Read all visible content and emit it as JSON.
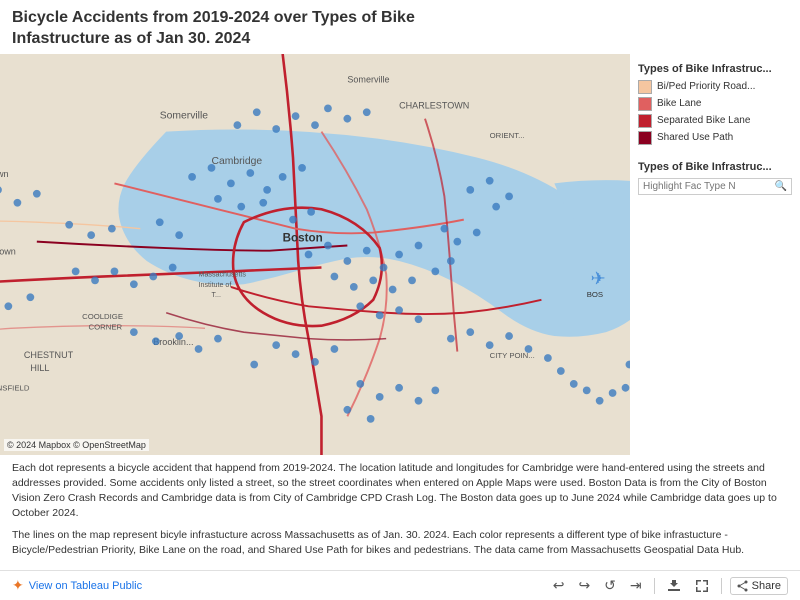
{
  "title": {
    "line1": "Bicycle Accidents from 2019-2024 over Types of Bike",
    "line2": "Infastructure as of Jan 30. 2024"
  },
  "legend": {
    "title": "Types of Bike Infrastruc...",
    "items": [
      {
        "label": "Bi/Ped Priority Road...",
        "color": "#f5c6a0"
      },
      {
        "label": "Bike Lane",
        "color": "#e06060"
      },
      {
        "label": "Separated Bike Lane",
        "color": "#c0202e"
      },
      {
        "label": "Shared Use Path",
        "color": "#8B0020"
      }
    ]
  },
  "filter": {
    "title": "Types of Bike Infrastruc...",
    "placeholder": "Highlight Fac Type N",
    "value": ""
  },
  "map_credit": "© 2024 Mapbox  © OpenStreetMap",
  "description": {
    "para1": "Each dot represents a bicycle accident that happend from 2019-2024. The location latitude and longitudes for Cambridge were hand-entered using the streets and addresses provided. Some accidents only listed a street, so the street coordinates when entered on Apple Maps were used. Boston Data is from the City of Boston Vision Zero Crash Records and Cambridge data is from City of Cambridge CPD Crash Log. The Boston data goes up to June 2024 while Cambridge data goes up to October 2024.",
    "para2": "The lines on the map represent bicyle infrastucture across Massachusetts as of Jan. 30. 2024. Each color represents a different type of bike infrastucture - Bicycle/Pedestrian Priority, Bike Lane on the road, and Shared Use Path for bikes and pedestrians. The data came from Massachusetts Geospatial Data Hub."
  },
  "footer": {
    "tableau_label": "View on Tableau Public",
    "share_label": "Share"
  },
  "controls": {
    "undo": "↩",
    "redo": "↪",
    "revert": "↺",
    "forward": "⇥",
    "pause": "⏸",
    "download": "⬇",
    "fullscreen": "⛶"
  }
}
